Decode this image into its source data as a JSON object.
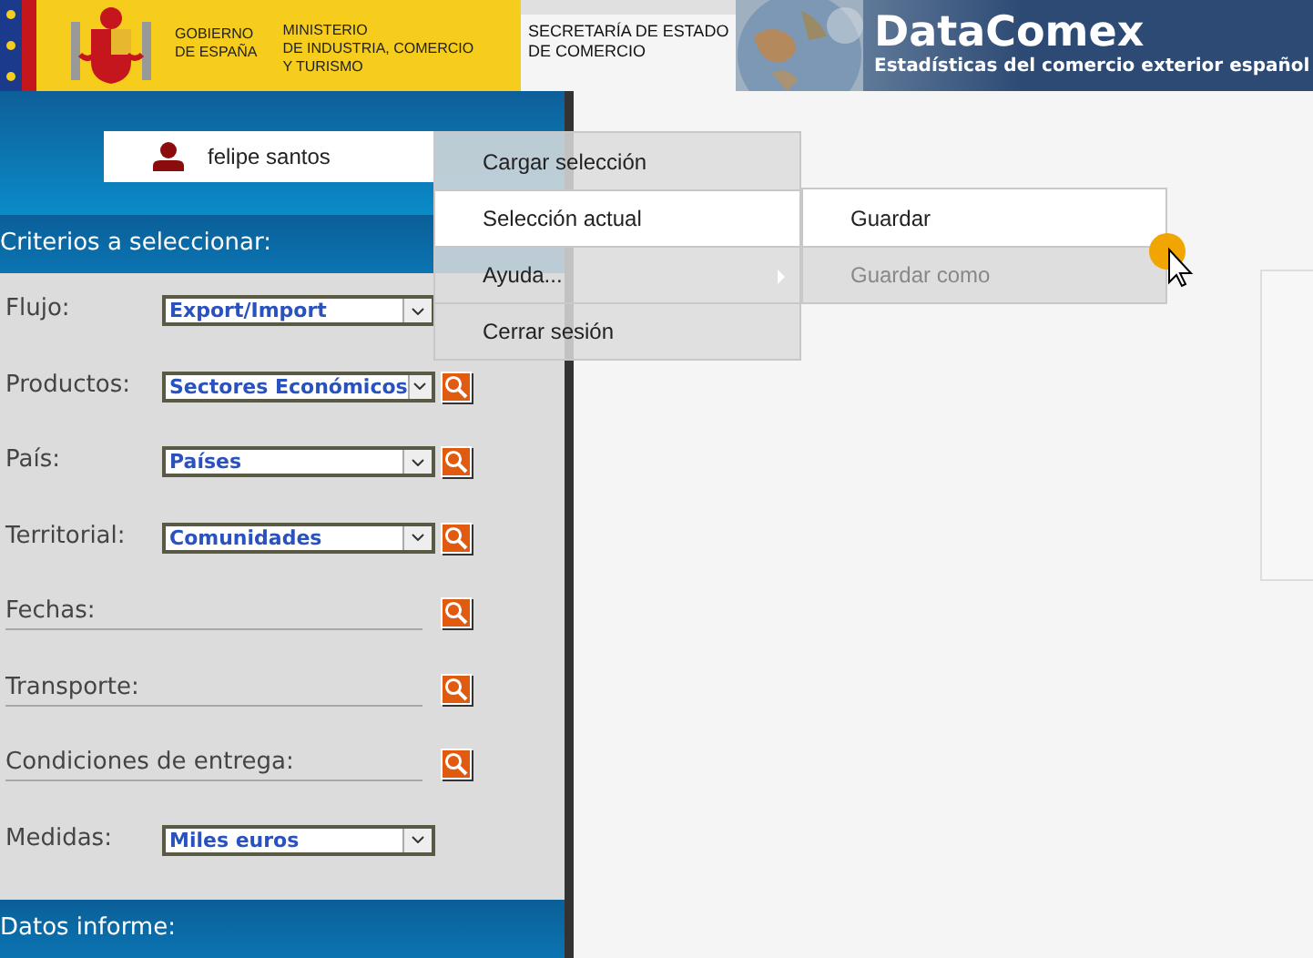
{
  "header": {
    "government": "GOBIERNO\nDE ESPAÑA",
    "ministry": "MINISTERIO\nDE INDUSTRIA, COMERCIO\nY TURISMO",
    "secretariat": "SECRETARÍA DE ESTADO\nDE COMERCIO",
    "app_title": "DataComex",
    "app_subtitle": "Estadísticas del comercio exterior español"
  },
  "user": {
    "name": "felipe santos"
  },
  "criteria_title": "Criterios a seleccionar:",
  "criteria": [
    {
      "kind": "select",
      "label": "Flujo:",
      "value": "Export/Import",
      "search": false
    },
    {
      "kind": "select",
      "label": "Productos:",
      "value": "Sectores Económicos",
      "search": true
    },
    {
      "kind": "select",
      "label": "País:",
      "value": "Países",
      "search": true
    },
    {
      "kind": "select",
      "label": "Territorial:",
      "value": "Comunidades",
      "search": true
    },
    {
      "kind": "line",
      "label": "Fechas:",
      "search": true
    },
    {
      "kind": "line",
      "label": "Transporte:",
      "search": true
    },
    {
      "kind": "line",
      "label": "Condiciones de entrega:",
      "search": true
    },
    {
      "kind": "select",
      "label": "Medidas:",
      "value": "Miles euros",
      "search": false
    }
  ],
  "report_title": "Datos informe:",
  "menu": [
    {
      "label": "Cargar selección",
      "selected": false,
      "submenu_arrow": false
    },
    {
      "label": "Selección actual",
      "selected": true,
      "submenu_arrow": false
    },
    {
      "label": "Ayuda...",
      "selected": false,
      "submenu_arrow": true
    },
    {
      "label": "Cerrar sesión",
      "selected": false,
      "submenu_arrow": false
    }
  ],
  "submenu": [
    {
      "label": "Guardar",
      "disabled": false
    },
    {
      "label": "Guardar como",
      "disabled": true
    }
  ]
}
